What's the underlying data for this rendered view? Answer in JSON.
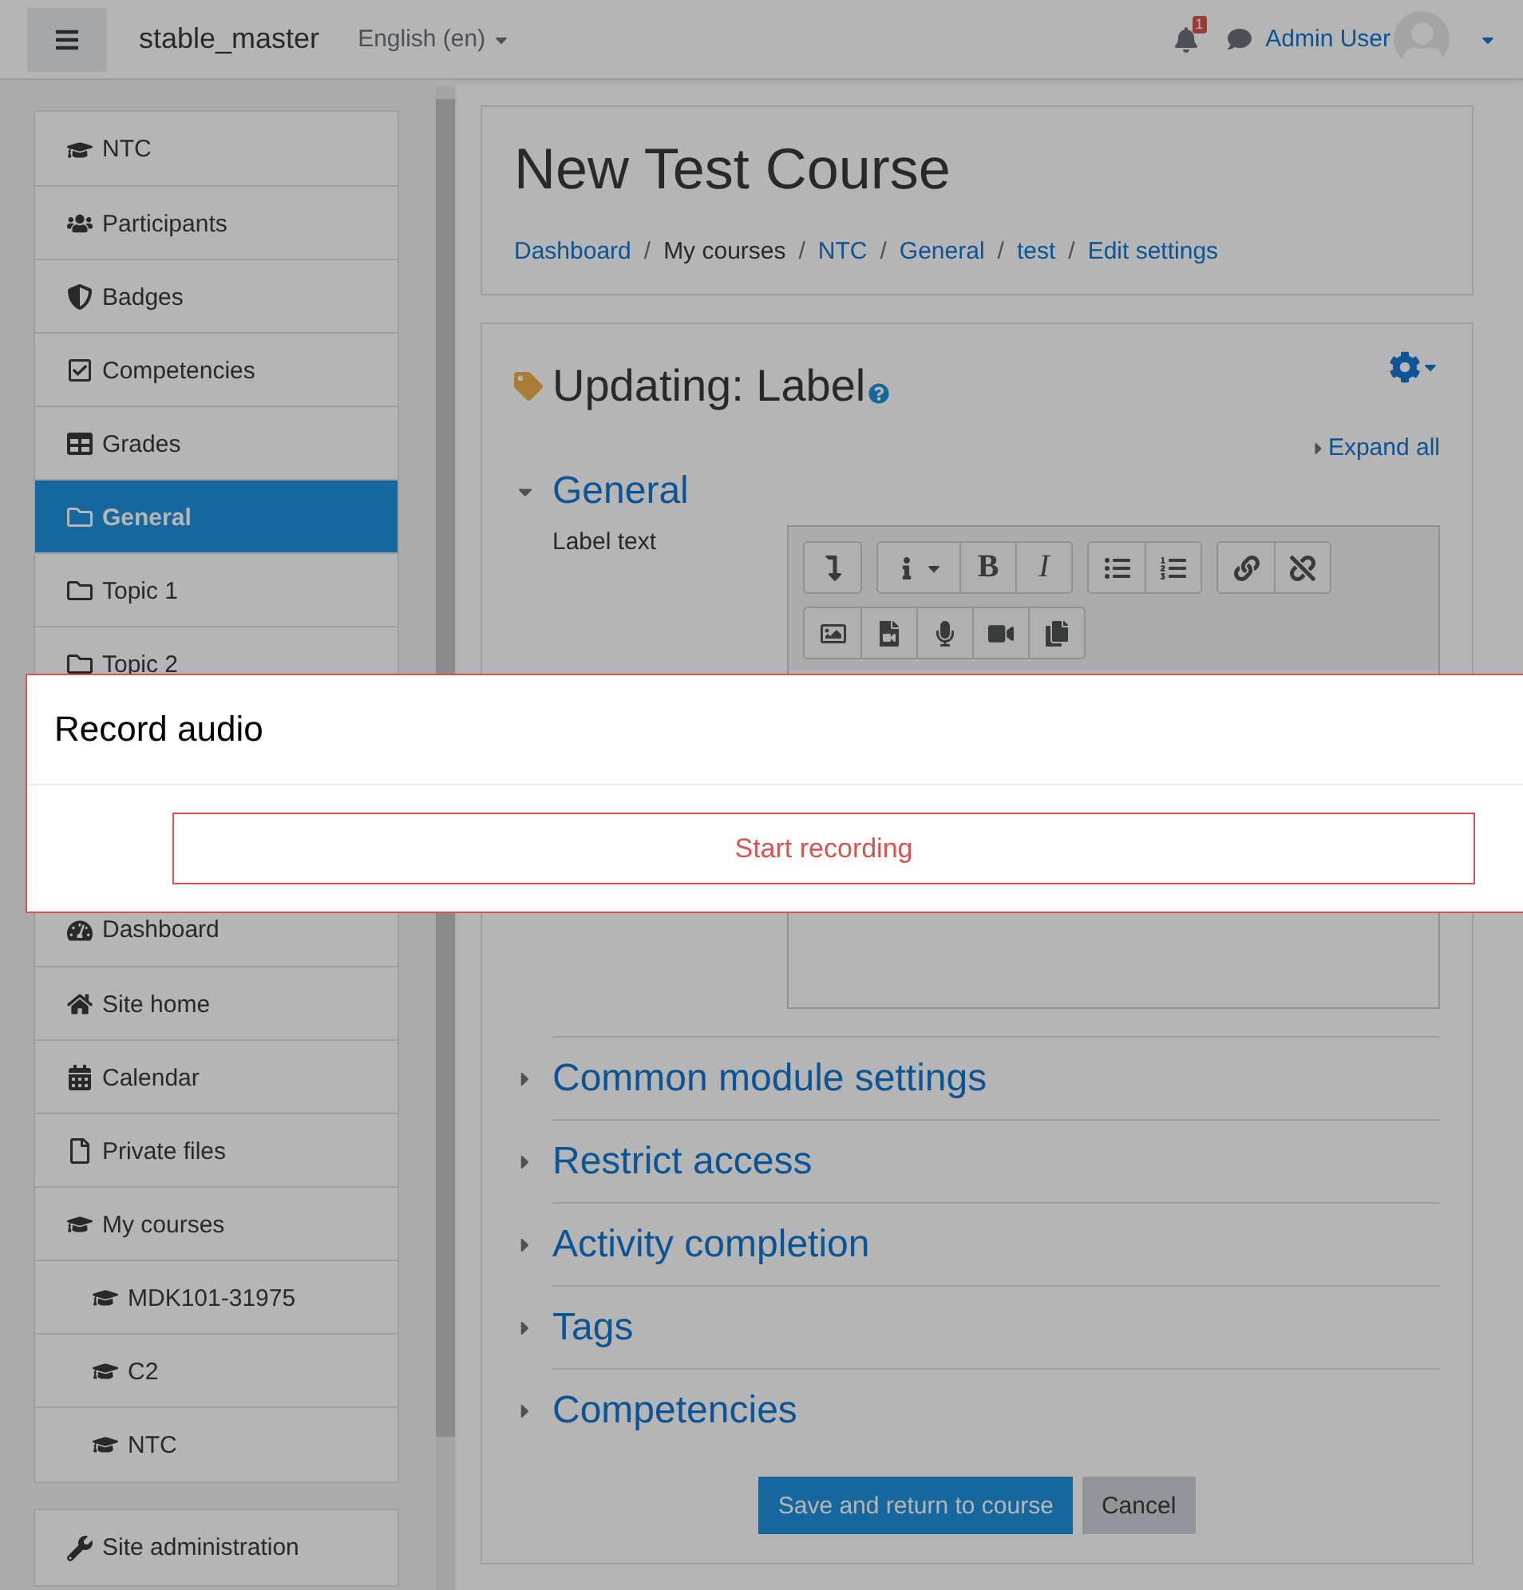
{
  "navbar": {
    "site_name": "stable_master",
    "language": "English (en)",
    "notification_count": "1",
    "user_name": "Admin User"
  },
  "sidebar": {
    "groups": [
      [
        {
          "kind": "course",
          "label": "NTC",
          "selected": false
        },
        {
          "kind": "participants",
          "label": "Participants",
          "selected": false
        },
        {
          "kind": "badges",
          "label": "Badges",
          "selected": false
        },
        {
          "kind": "competencies",
          "label": "Competencies",
          "selected": false
        },
        {
          "kind": "grades",
          "label": "Grades",
          "selected": false
        },
        {
          "kind": "folder",
          "label": "General",
          "selected": true
        },
        {
          "kind": "folder",
          "label": "Topic 1",
          "selected": false
        },
        {
          "kind": "folder",
          "label": "Topic 2",
          "selected": false
        }
      ],
      [
        {
          "kind": "dashboard",
          "label": "Dashboard",
          "selected": false
        },
        {
          "kind": "home",
          "label": "Site home",
          "selected": false
        },
        {
          "kind": "calendar",
          "label": "Calendar",
          "selected": false
        },
        {
          "kind": "file",
          "label": "Private files",
          "selected": false
        },
        {
          "kind": "course",
          "label": "My courses",
          "selected": false,
          "children": [
            {
              "kind": "course",
              "label": "MDK101-31975",
              "selected": false
            },
            {
              "kind": "course",
              "label": "C2",
              "selected": false
            },
            {
              "kind": "course",
              "label": "NTC",
              "selected": false
            }
          ]
        }
      ],
      [
        {
          "kind": "wrench",
          "label": "Site administration",
          "selected": false
        }
      ]
    ]
  },
  "header": {
    "title": "New Test Course",
    "separator": "/",
    "breadcrumbs": [
      {
        "label": "Dashboard",
        "link": true
      },
      {
        "label": "My courses",
        "link": false
      },
      {
        "label": "NTC",
        "link": true
      },
      {
        "label": "General",
        "link": true
      },
      {
        "label": "test",
        "link": true
      },
      {
        "label": "Edit settings",
        "link": true
      }
    ]
  },
  "form": {
    "title": "Updating: Label",
    "expand_all": "Expand all",
    "sections": [
      {
        "title": "General",
        "expanded": true,
        "field": {
          "label": "Label text",
          "toolbar_rows": [
            [
              [
                {
                  "kind": "indent"
                }
              ],
              [
                {
                  "kind": "info"
                },
                {
                  "kind": "bold",
                  "text": "B"
                },
                {
                  "kind": "italic",
                  "text": "I"
                }
              ],
              [
                {
                  "kind": "bullets"
                },
                {
                  "kind": "numbers"
                }
              ],
              [
                {
                  "kind": "link"
                },
                {
                  "kind": "unlink"
                }
              ]
            ],
            [
              [
                {
                  "kind": "image"
                },
                {
                  "kind": "video-file"
                },
                {
                  "kind": "microphone"
                },
                {
                  "kind": "camera"
                },
                {
                  "kind": "copy"
                }
              ]
            ]
          ]
        }
      },
      {
        "title": "Common module settings",
        "expanded": false
      },
      {
        "title": "Restrict access",
        "expanded": false
      },
      {
        "title": "Activity completion",
        "expanded": false
      },
      {
        "title": "Tags",
        "expanded": false
      },
      {
        "title": "Competencies",
        "expanded": false
      }
    ],
    "buttons": [
      {
        "label": "Save and return to course",
        "kind": "primary"
      },
      {
        "label": "Cancel",
        "kind": "secondary"
      }
    ]
  },
  "dialog": {
    "title": "Record audio",
    "button": "Start recording"
  }
}
